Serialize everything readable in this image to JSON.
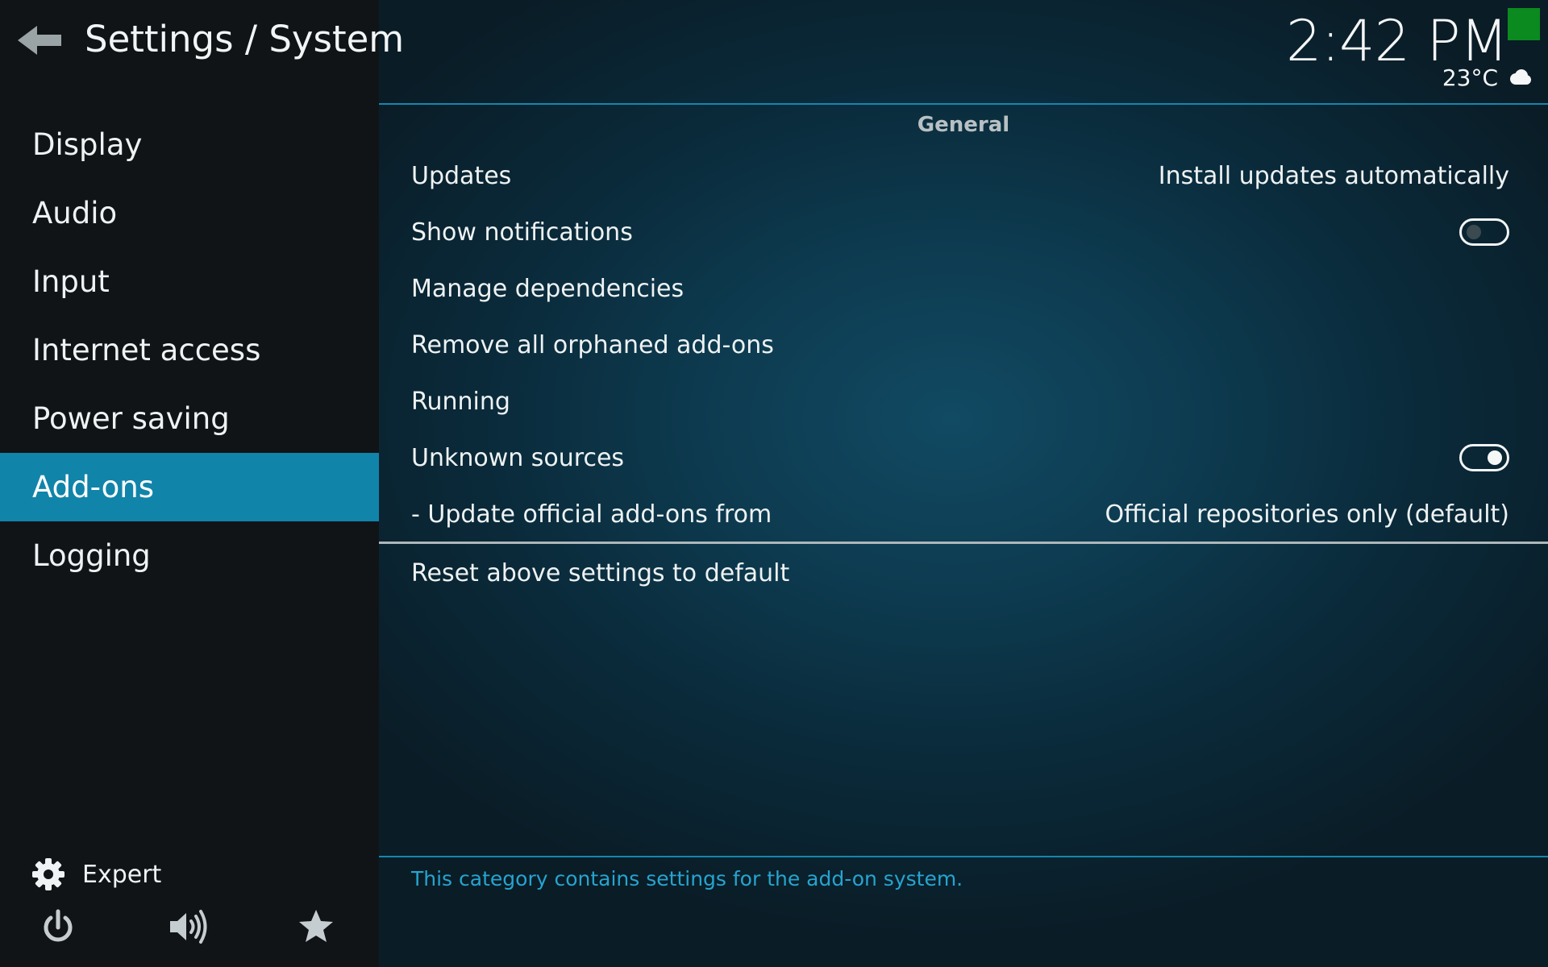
{
  "header": {
    "title": "Settings / System",
    "back_icon": "arrow-left-icon"
  },
  "sidebar": {
    "items": [
      {
        "label": "Display",
        "active": false
      },
      {
        "label": "Audio",
        "active": false
      },
      {
        "label": "Input",
        "active": false
      },
      {
        "label": "Internet access",
        "active": false
      },
      {
        "label": "Power saving",
        "active": false
      },
      {
        "label": "Add-ons",
        "active": true
      },
      {
        "label": "Logging",
        "active": false
      }
    ],
    "expert_label": "Expert",
    "bottom_icons": [
      "power-icon",
      "volume-icon",
      "star-icon"
    ]
  },
  "status": {
    "time": "2:42 PM",
    "temperature": "23°C",
    "weather_icon": "cloud-icon"
  },
  "main": {
    "group_title": "General",
    "settings": [
      {
        "label": "Updates",
        "value": "Install updates automatically"
      },
      {
        "label": "Show notifications",
        "toggle": "off"
      },
      {
        "label": "Manage dependencies"
      },
      {
        "label": "Remove all orphaned add-ons"
      },
      {
        "label": "Running"
      },
      {
        "label": "Unknown sources",
        "toggle": "on"
      },
      {
        "label": "- Update official add-ons from",
        "value": "Official repositories only (default)"
      }
    ],
    "reset_label": "Reset above settings to default",
    "help_text": "This category contains settings for the add-on system."
  },
  "colors": {
    "accent": "#1184aa",
    "sidebar_bg": "#111416",
    "help_text": "#26a4cf",
    "status_indicator": "#0b8a1f"
  }
}
